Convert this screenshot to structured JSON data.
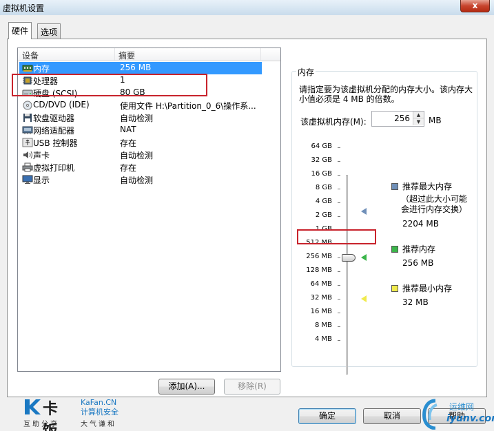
{
  "window": {
    "title": "虚拟机设置",
    "close_label": "x"
  },
  "tabs": [
    {
      "label": "硬件",
      "active": true
    },
    {
      "label": "选项",
      "active": false
    }
  ],
  "device_list": {
    "columns": [
      "设备",
      "摘要"
    ],
    "rows": [
      {
        "icon": "memory-icon",
        "name": "内存",
        "summary": "256 MB",
        "selected": true
      },
      {
        "icon": "processor-icon",
        "name": "处理器",
        "summary": "1"
      },
      {
        "icon": "hard-disk-icon",
        "name": "硬盘 (SCSI)",
        "summary": "80 GB"
      },
      {
        "icon": "cd-dvd-icon",
        "name": "CD/DVD (IDE)",
        "summary": "使用文件 H:\\Partition_0_6\\操作系..."
      },
      {
        "icon": "floppy-icon",
        "name": "软盘驱动器",
        "summary": "自动检测"
      },
      {
        "icon": "network-adapter-icon",
        "name": "网络适配器",
        "summary": "NAT"
      },
      {
        "icon": "usb-icon",
        "name": "USB 控制器",
        "summary": "存在"
      },
      {
        "icon": "sound-card-icon",
        "name": "声卡",
        "summary": "自动检测"
      },
      {
        "icon": "printer-icon",
        "name": "虚拟打印机",
        "summary": "存在"
      },
      {
        "icon": "display-icon",
        "name": "显示",
        "summary": "自动检测"
      }
    ]
  },
  "buttons": {
    "add": "添加(A)...",
    "remove": "移除(R)",
    "ok": "确定",
    "cancel": "取消",
    "help": "帮助"
  },
  "memory": {
    "group_title": "内存",
    "description": "请指定要为该虚拟机分配的内存大小。该内存大小值必须是 4 MB 的倍数。",
    "field_label": "该虚拟机内存(M):",
    "value": "256",
    "unit": "MB",
    "scale": [
      "64 GB",
      "32 GB",
      "16 GB",
      "8 GB",
      "4 GB",
      "2 GB",
      "1 GB",
      "512 MB",
      "256 MB",
      "128 MB",
      "64 MB",
      "32 MB",
      "16 MB",
      "8 MB",
      "4 MB"
    ],
    "slider_value": "256 MB",
    "legend": {
      "max_title": "推荐最大内存",
      "max_note": "（超过此大小可能会进行内存交换）",
      "max_value": "2204 MB",
      "rec_title": "推荐内存",
      "rec_value": "256 MB",
      "min_title": "推荐最小内存",
      "min_value": "32 MB"
    },
    "colors": {
      "max": "#6f8fb8",
      "rec": "#3bb54a",
      "min": "#f0ea4c"
    }
  },
  "branding": {
    "logo_cn": "卡饭",
    "logo_en": "KaFan.CN",
    "logo_sub": "计算机安全",
    "slogan_left": "互助分享",
    "slogan_right": "大气谦和",
    "watermark_cn": "运维网",
    "watermark_en": "iyunv.com"
  }
}
